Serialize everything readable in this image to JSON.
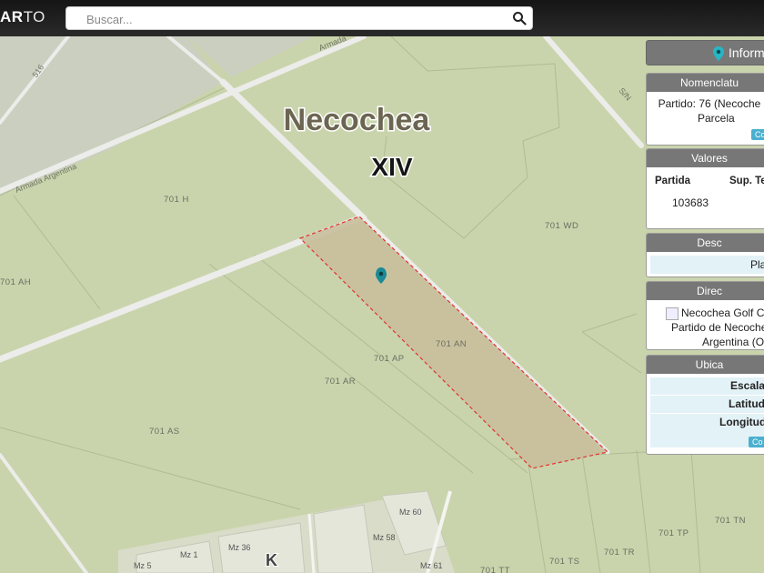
{
  "header": {
    "logo_bold": "AR",
    "logo_light": "TO",
    "search_placeholder": "Buscar..."
  },
  "map": {
    "city_label": "Necochea",
    "zone_label": "XIV",
    "colors": {
      "land": "#c9d4ac",
      "road": "#ececea",
      "parcel_fill": "#c9bf9c",
      "parcel_border": "#e0332f",
      "marker": "#1a8a96"
    },
    "street_labels": [
      "Armada Argentina",
      "Armada",
      "516",
      "S/N"
    ],
    "parcel_labels": [
      "701 H",
      "701 WD",
      "701 AH",
      "701 AN",
      "701 AP",
      "701 AR",
      "701 AS",
      "701 TP",
      "701 TN",
      "701 TS",
      "701 TR",
      "701 TT"
    ],
    "block_labels": [
      "Mz 60",
      "Mz 58",
      "Mz 36",
      "Mz 1",
      "Mz 5",
      "Mz 61",
      "K"
    ]
  },
  "panel": {
    "title": "Inform",
    "nomenclatura": {
      "header": "Nomenclatu",
      "line1": "Partido: 76 (Necoche",
      "line2": "Parcela",
      "button": "Co"
    },
    "valores": {
      "header": "Valores",
      "col1": "Partida",
      "col2": "Sup. Te",
      "partida": "103683"
    },
    "descripcion": {
      "header": "Desc",
      "value": "Pla"
    },
    "direccion": {
      "header": "Direc",
      "line1": "Necochea Golf Clu",
      "line2": "Partido de Necochea",
      "line3": "Argentina (Op"
    },
    "ubicacion": {
      "header": "Ubica",
      "escala": "Escala:",
      "latitud": "Latitud:",
      "longitud": "Longitud:",
      "button": "Co"
    }
  }
}
